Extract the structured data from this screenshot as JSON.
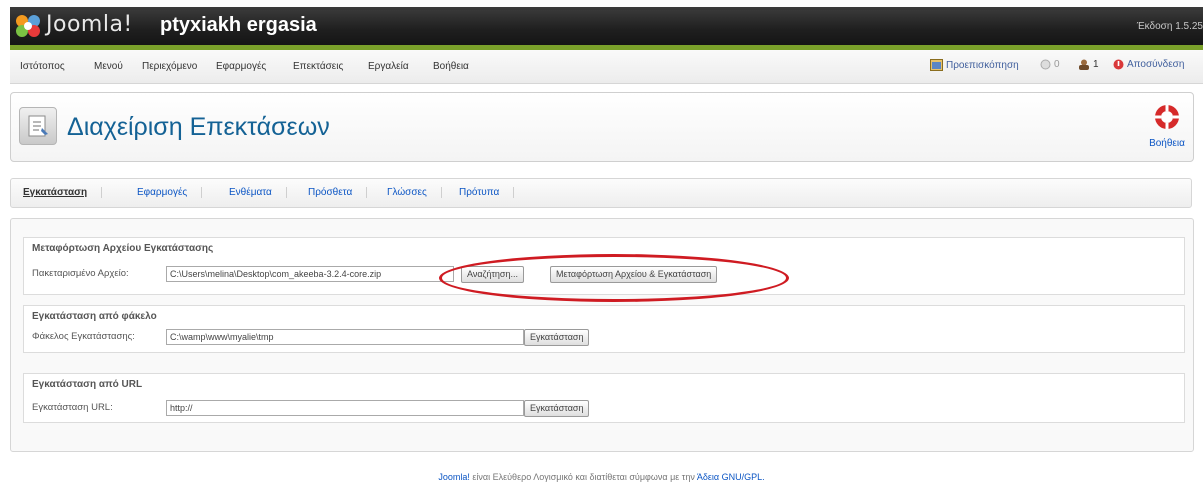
{
  "header": {
    "logo_text": "Joomla!",
    "site_name": "ptyxiakh ergasia",
    "version": "Έκδοση 1.5.25"
  },
  "menu": {
    "items": [
      {
        "id": "site",
        "label": "Ιστότοπος"
      },
      {
        "id": "menus",
        "label": "Μενού"
      },
      {
        "id": "content",
        "label": "Περιεχόμενο"
      },
      {
        "id": "components",
        "label": "Εφαρμογές"
      },
      {
        "id": "extensions",
        "label": "Επεκτάσεις"
      },
      {
        "id": "tools",
        "label": "Εργαλεία"
      },
      {
        "id": "help",
        "label": "Βοήθεια"
      }
    ],
    "preview": "Προεπισκόπηση",
    "messages": "0",
    "users": "1",
    "logout": "Αποσύνδεση"
  },
  "toolbar": {
    "title": "Διαχείριση Επεκτάσεων",
    "help": "Βοήθεια"
  },
  "tabs": [
    {
      "id": "install",
      "label": "Εγκατάσταση",
      "active": true
    },
    {
      "id": "components",
      "label": "Εφαρμογές"
    },
    {
      "id": "modules",
      "label": "Ενθέματα"
    },
    {
      "id": "plugins",
      "label": "Πρόσθετα"
    },
    {
      "id": "languages",
      "label": "Γλώσσες"
    },
    {
      "id": "templates",
      "label": "Πρότυπα"
    }
  ],
  "upload": {
    "legend": "Μεταφόρτωση Αρχείου Εγκατάστασης",
    "label": "Πακεταρισμένο Αρχείο:",
    "value": "C:\\Users\\melina\\Desktop\\com_akeeba-3.2.4-core.zip",
    "browse": "Αναζήτηση...",
    "submit": "Μεταφόρτωση Αρχείου & Εγκατάσταση"
  },
  "folder": {
    "legend": "Εγκατάσταση από φάκελο",
    "label": "Φάκελος Εγκατάστασης:",
    "value": "C:\\wamp\\www\\myalie\\tmp",
    "submit": "Εγκατάσταση"
  },
  "url": {
    "legend": "Εγκατάσταση από URL",
    "label": "Εγκατάσταση URL:",
    "value": "http://",
    "submit": "Εγκατάσταση"
  },
  "footer": {
    "joomla": "Joomla!",
    "text": " είναι Ελεύθερο Λογισμικό και διατίθεται σύμφωνα με την ",
    "license": "Άδεια GNU/GPL."
  },
  "colors": {
    "accent": "#146295",
    "link": "#0b55c4",
    "highlight_ellipse": "#cf1b22",
    "header_green": "#7aa12a"
  }
}
